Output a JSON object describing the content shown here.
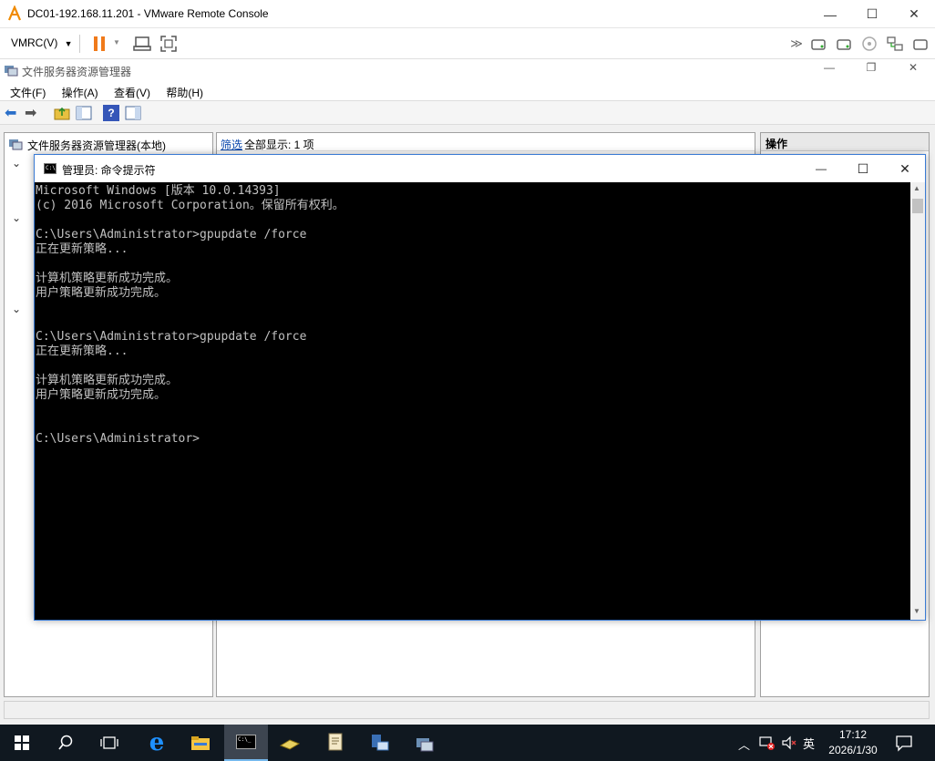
{
  "vmrc": {
    "title": "DC01-192.168.11.201 - VMware Remote Console",
    "menu_label": "VMRC(V)",
    "minimize": "—",
    "maximize": "☐",
    "close": "✕"
  },
  "fsrm": {
    "title": "文件服务器资源管理器",
    "menu": [
      "文件(F)",
      "操作(A)",
      "查看(V)",
      "帮助(H)"
    ],
    "tree_root": "文件服务器资源管理器(本地)",
    "filter_link": "筛选",
    "filter_text": "全部显示: 1 项",
    "actions_header": "操作"
  },
  "cmd": {
    "title": "管理员: 命令提示符",
    "lines": [
      "Microsoft Windows [版本 10.0.14393]",
      "(c) 2016 Microsoft Corporation。保留所有权利。",
      "",
      "C:\\Users\\Administrator>gpupdate /force",
      "正在更新策略...",
      "",
      "计算机策略更新成功完成。",
      "用户策略更新成功完成。",
      "",
      "",
      "C:\\Users\\Administrator>gpupdate /force",
      "正在更新策略...",
      "",
      "计算机策略更新成功完成。",
      "用户策略更新成功完成。",
      "",
      "",
      "C:\\Users\\Administrator>"
    ]
  },
  "taskbar": {
    "time": "17:12",
    "date": "2026/1/30",
    "ime": "英"
  }
}
